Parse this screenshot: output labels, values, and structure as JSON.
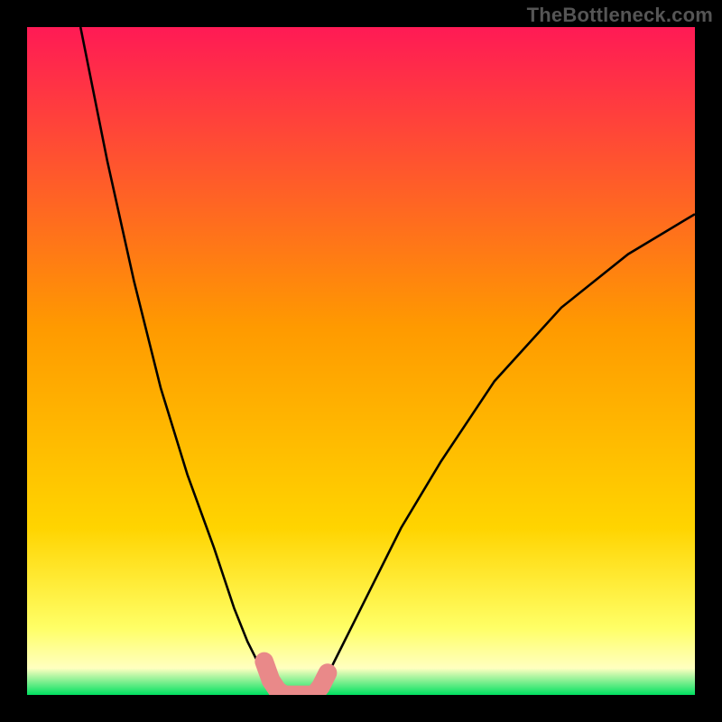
{
  "watermark": "TheBottleneck.com",
  "chart_data": {
    "type": "line",
    "title": "",
    "xlabel": "",
    "ylabel": "",
    "xlim": [
      0,
      100
    ],
    "ylim": [
      0,
      100
    ],
    "grid": false,
    "legend": false,
    "series": [
      {
        "name": "left-branch",
        "x": [
          8,
          12,
          16,
          20,
          24,
          28,
          31,
          33,
          35,
          36.5,
          38
        ],
        "values": [
          100,
          80,
          62,
          46,
          33,
          22,
          13,
          8,
          4,
          1.5,
          0
        ]
      },
      {
        "name": "right-branch",
        "x": [
          43,
          45,
          48,
          52,
          56,
          62,
          70,
          80,
          90,
          100
        ],
        "values": [
          0,
          3,
          9,
          17,
          25,
          35,
          47,
          58,
          66,
          72
        ]
      }
    ],
    "highlight": {
      "name": "notch-highlight",
      "color": "#e98989",
      "x": [
        35.5,
        36.5,
        37.5,
        38.5,
        40,
        41.5,
        43,
        44,
        45
      ],
      "values": [
        5,
        2.2,
        0.7,
        0,
        0,
        0,
        0,
        1.3,
        3.3
      ]
    },
    "background_gradient_top": "#ff1a55",
    "background_gradient_mid": "#ffd400",
    "background_gradient_lower": "#ffff66",
    "background_gradient_band": "#ffffc0",
    "background_gradient_bottom": "#00e060",
    "curve_color": "#000000"
  }
}
